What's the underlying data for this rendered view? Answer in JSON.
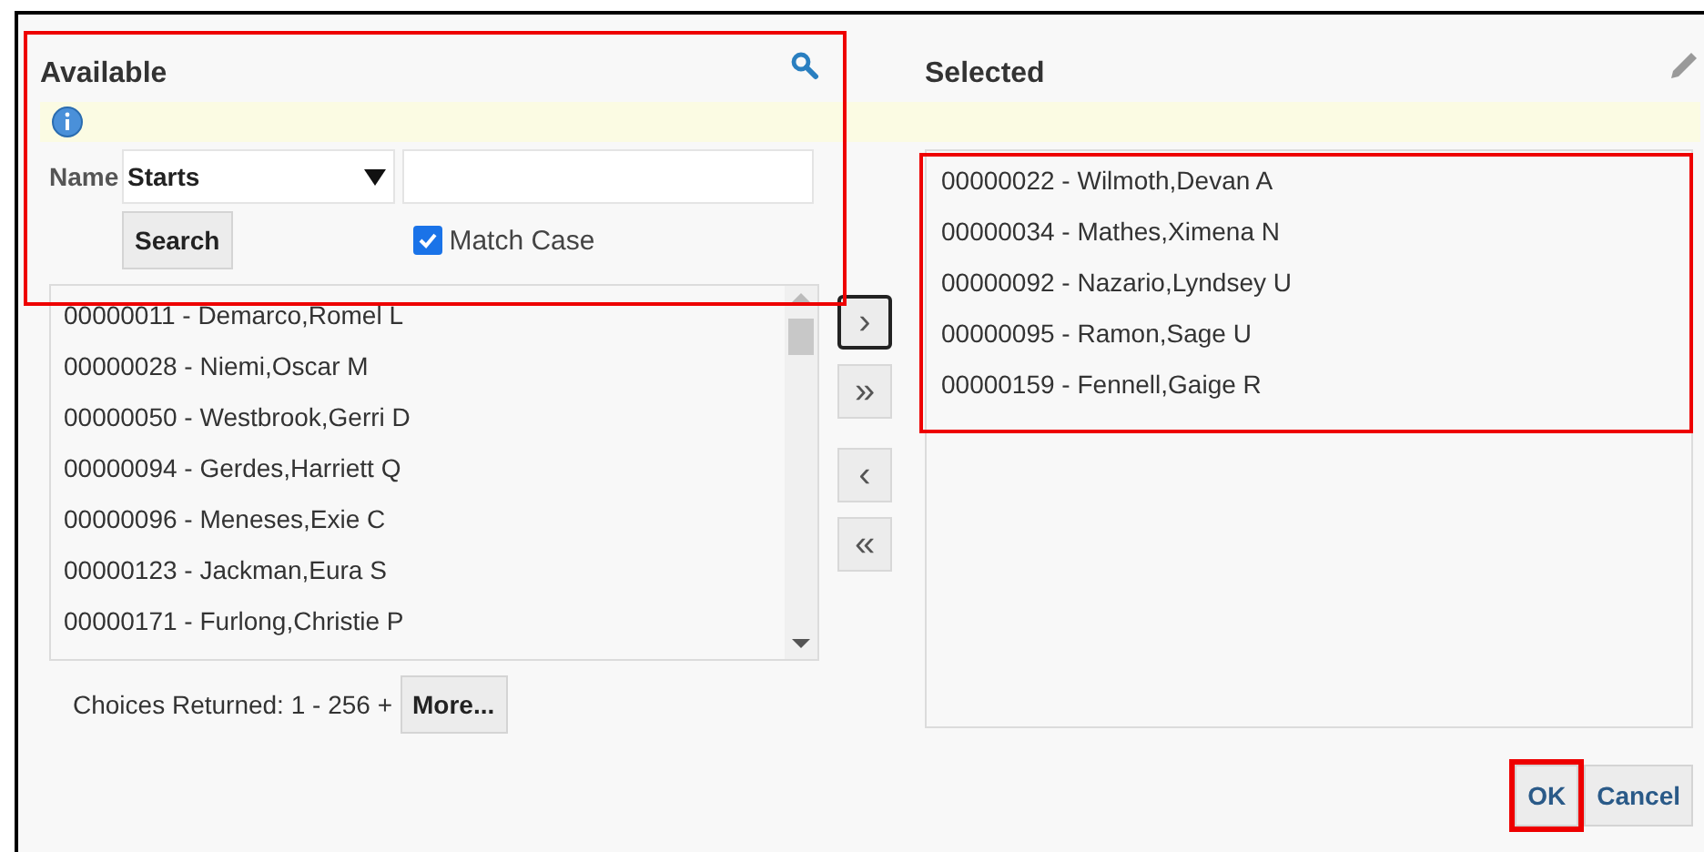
{
  "available": {
    "title": "Available",
    "highlighted": true,
    "filter": {
      "label": "Name",
      "operator": "Starts"
    },
    "search_button": "Search",
    "match_case": {
      "label": "Match Case",
      "checked": true
    },
    "items": [
      {
        "label": "00000011 - Demarco,Romel L"
      },
      {
        "label": "00000028 - Niemi,Oscar M"
      },
      {
        "label": "00000050 - Westbrook,Gerri D"
      },
      {
        "label": "00000094 - Gerdes,Harriett Q"
      },
      {
        "label": "00000096 - Meneses,Exie C"
      },
      {
        "label": "00000123 - Jackman,Eura S"
      },
      {
        "label": "00000171 - Furlong,Christie P"
      }
    ],
    "choices_returned": "Choices Returned: 1 - 256 +",
    "more_button": "More..."
  },
  "shuttle": [
    {
      "kind": "move",
      "label": "›",
      "focused": true
    },
    {
      "kind": "move_all",
      "label": "»",
      "focused": false
    },
    {
      "kind": "remove",
      "label": "‹",
      "focused": false
    },
    {
      "kind": "remove_all",
      "label": "«",
      "focused": false
    }
  ],
  "selected": {
    "title": "Selected",
    "highlighted": true,
    "items": [
      {
        "label": "00000022 - Wilmoth,Devan A"
      },
      {
        "label": "00000034 - Mathes,Ximena N"
      },
      {
        "label": "00000092 - Nazario,Lyndsey U"
      },
      {
        "label": "00000095 - Ramon,Sage U"
      },
      {
        "label": "00000159 - Fennell,Gaige R"
      }
    ]
  },
  "buttons": [
    {
      "label": "OK",
      "highlighted": true
    },
    {
      "label": "Cancel",
      "highlighted": false
    }
  ]
}
